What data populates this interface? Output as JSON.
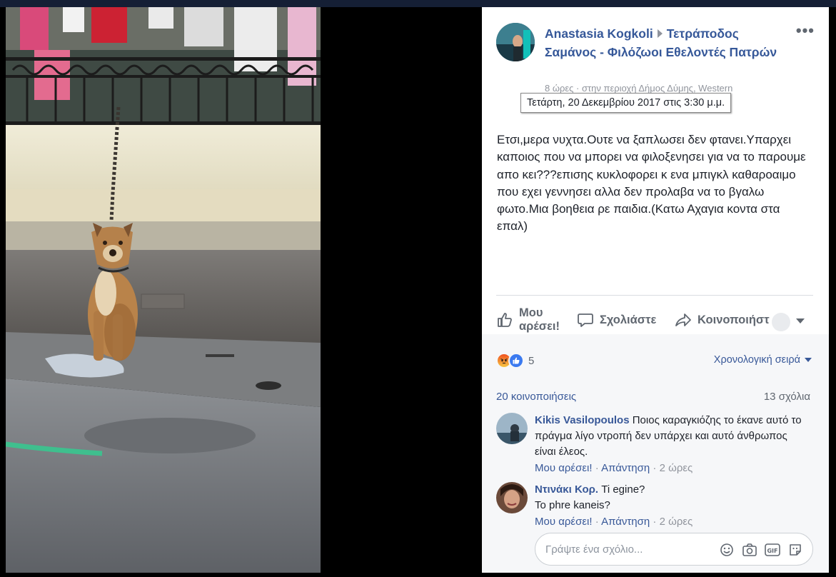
{
  "post": {
    "author": "Anastasia Kogkoli",
    "group": "Τετράποδος Σαμάνος - Φιλόζωοι Εθελοντές Πατρών",
    "subline": "8 ώρες · στην περιοχή Δήμος Δύμης, Western",
    "tooltip": "Τετάρτη, 20 Δεκεμβρίου 2017 στις 3:30 μ.μ.",
    "text": "Ετσι,μερα νυχτα.Ουτε να ξαπλωσει δεν φτανει.Υπαρχει καποιος που να μπορει να φιλοξενησει για να το παρουμε απο κει???επισης κυκλοφορει κ ενα μπιγκλ καθαροαιμο που εχει γεννησει αλλα δεν προλαβα να το βγαλω φωτο.Μια βοηθεια ρε παιδια.(Κατω Αχαγια κοντα στα επαλ)"
  },
  "actions": {
    "like_line1": "Μου",
    "like_line2": "αρέσει!",
    "comment": "Σχολιάστε",
    "share": "Κοινοποιήστ"
  },
  "stats": {
    "reaction_count": "5",
    "order": "Χρονολογική σειρά",
    "shares": "20 κοινοποιήσεις",
    "comments": "13 σχόλια"
  },
  "comments": [
    {
      "name": "Kikis Vasilopoulos",
      "text": "Ποιος καραγκιόζης το έκανε αυτό το πράγμα λίγο ντροπή δεν υπάρχει και αυτό άνθρωπος είναι έλεος.",
      "like": "Μου αρέσει!",
      "reply": "Απάντηση",
      "time": "2 ώρες"
    },
    {
      "name": "Ντινάκι Κορ.",
      "text": "Ti egine?",
      "text2": "To phre kaneis?",
      "like": "Μου αρέσει!",
      "reply": "Απάντηση",
      "time": "2 ώρες"
    }
  ],
  "composer": {
    "placeholder": "Γράψτε ένα σχόλιο..."
  },
  "colors": {
    "link": "#385898",
    "author": "#365899",
    "text": "#1d2129",
    "muted": "#90949c"
  }
}
